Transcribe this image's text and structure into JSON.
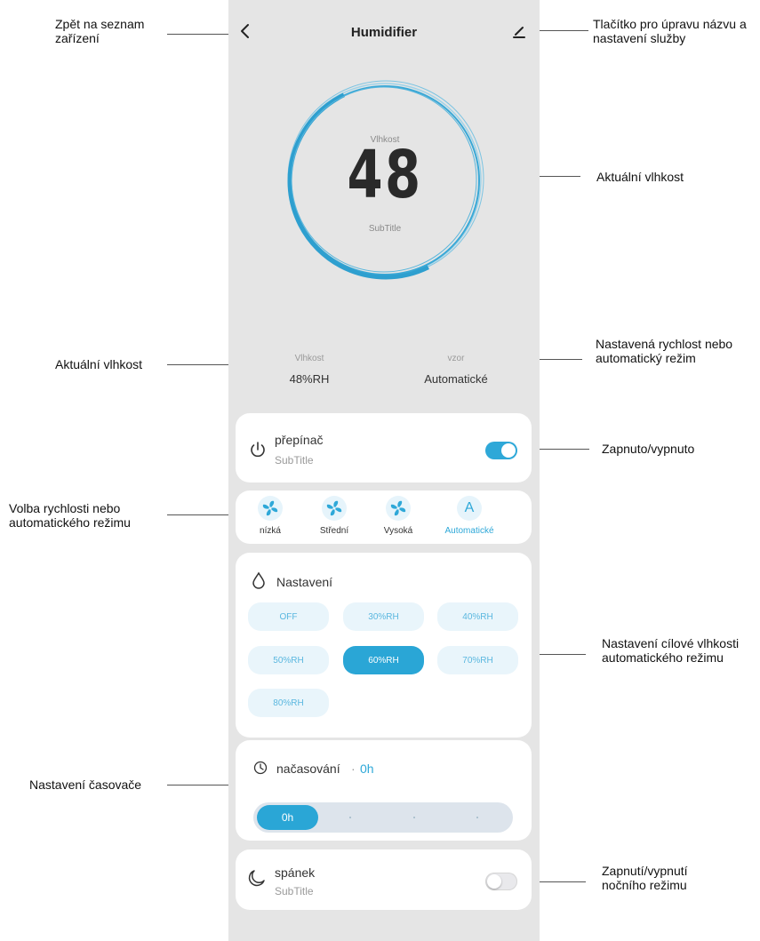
{
  "header": {
    "title": "Humidifier"
  },
  "display": {
    "label": "Vlhkost",
    "value": "48",
    "subtitle": "SubTitle"
  },
  "stats": [
    {
      "label": "Vlhkost",
      "value": "48%RH"
    },
    {
      "label": "vzor",
      "value": "Automatické"
    }
  ],
  "power": {
    "title": "přepínač",
    "subtitle": "SubTitle",
    "on": true
  },
  "modes": [
    {
      "label": "nízká",
      "icon": "fan-icon",
      "active": false
    },
    {
      "label": "Střední",
      "icon": "fan-icon",
      "active": false
    },
    {
      "label": "Vysoká",
      "icon": "fan-icon",
      "active": false
    },
    {
      "label": "Automatické",
      "icon": "auto-icon",
      "active": true,
      "glyph": "A"
    }
  ],
  "setting": {
    "title": "Nastavení",
    "options": [
      "OFF",
      "30%RH",
      "40%RH",
      "50%RH",
      "60%RH",
      "70%RH",
      "80%RH"
    ],
    "selected": "60%RH"
  },
  "timer": {
    "title": "načasování",
    "separator": "·",
    "value": "0h",
    "selected_label": "0h",
    "steps": 4
  },
  "sleep": {
    "title": "spánek",
    "subtitle": "SubTitle",
    "on": false
  },
  "annotations": {
    "back": "Zpět na seznam zařízení",
    "edit": "Tlačítko pro úpravu názvu a nastavení služby",
    "current_humidity_ring": "Aktuální vlhkost",
    "current_humidity": "Aktuální vlhkost",
    "speed_mode": "Nastavená rychlost nebo automatický režim",
    "power": "Zapnuto/vypnuto",
    "speed_select": "Volba rychlosti nebo automatického režimu",
    "target_humidity": "Nastavení cílové vlhkosti automatického režimu",
    "timer": "Nastavení časovače",
    "night": "Zapnutí/vypnutí nočního režimu"
  },
  "colors": {
    "accent": "#2ea8d8",
    "phone_bg": "#e5e5e5",
    "card_bg": "#ffffff"
  }
}
